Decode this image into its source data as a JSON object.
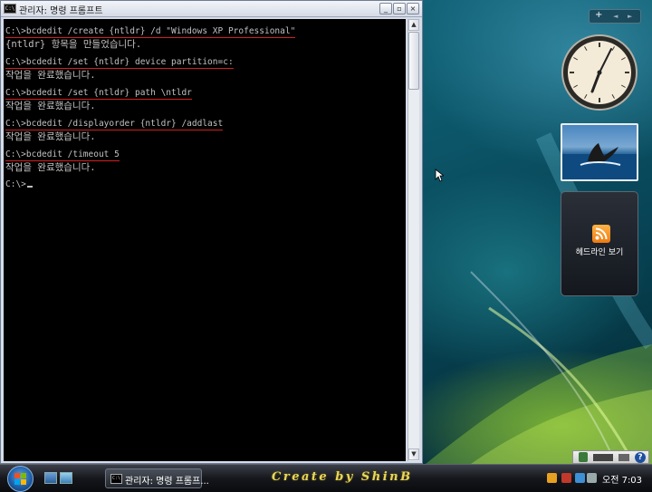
{
  "window": {
    "title": "관리자: 명령 프롬프트",
    "icon_text": "C:\\",
    "btn_minimize": "_",
    "btn_restore": "▫",
    "btn_close": "×"
  },
  "console": {
    "lines": [
      "C:\\>bcdedit /create {ntldr} /d \"Windows XP Professional\"",
      "{ntldr} 항목을 만들었습니다.",
      "",
      "C:\\>bcdedit /set {ntldr} device partition=c:",
      "작업을 완료했습니다.",
      "",
      "C:\\>bcdedit /set {ntldr} path \\ntldr",
      "작업을 완료했습니다.",
      "",
      "C:\\>bcdedit /displayorder {ntldr} /addlast",
      "작업을 완료했습니다.",
      "",
      "C:\\>bcdedit /timeout 5",
      "작업을 완료했습니다.",
      "",
      "C:\\>"
    ]
  },
  "scrollbar": {
    "up_arrow": "▲",
    "down_arrow": "▼"
  },
  "sidebar": {
    "add_label": "+",
    "prev_label": "◄",
    "next_label": "►",
    "feed_gadget_label": "헤드라인 보기"
  },
  "taskbar": {
    "task_button_label": "관리자: 명령 프롬프...",
    "task_button_icon_text": "C:\\",
    "brand_text": "Create by ShinB",
    "clock": "오전 7:03",
    "help_label": "?"
  },
  "colors": {
    "console_bg": "#000000",
    "console_text": "#c0c0c0",
    "underline_red": "#d02020",
    "brand_gold": "#e8d65a"
  }
}
